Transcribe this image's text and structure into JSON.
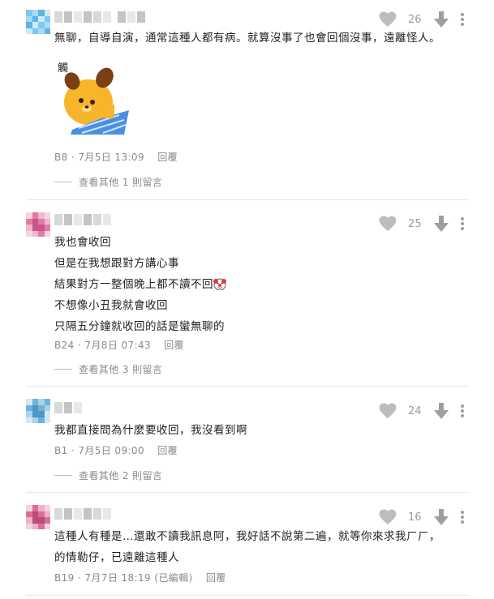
{
  "comments": [
    {
      "text_lines": [
        "無聊，自導自演，通常這種人都有病。就算沒事了也會回個沒事，遠離怪人。"
      ],
      "likes": "26",
      "floor": "B8",
      "date": "7月5日 13:09",
      "reply_label": "回覆",
      "view_more": "查看其他 1 則留言",
      "sticker_text": "觸",
      "avatar_colors": [
        "#7ec8f0",
        "#a9d9f5",
        "#5fb3e6",
        "#cfe9f8"
      ]
    },
    {
      "text_lines": [
        "我也會收回",
        "但是在我想跟對方講心事",
        "結果對方一整個晚上都不讀不回",
        "不想像小丑我就會收回",
        "只隔五分鐘就收回的話是蠻無聊的"
      ],
      "likes": "25",
      "floor": "B24",
      "date": "7月8日 07:43",
      "reply_label": "回覆",
      "view_more": "查看其他 3 則留言",
      "avatar_colors": [
        "#e07aa6",
        "#f2b6cf",
        "#c9558a",
        "#f7d4e3"
      ]
    },
    {
      "text_lines": [
        "我都直接問為什麼要收回，我沒看到啊"
      ],
      "likes": "24",
      "floor": "B1",
      "date": "7月5日 09:00",
      "reply_label": "回覆",
      "view_more": "查看其他 2 則留言",
      "avatar_colors": [
        "#6fb2d8",
        "#a7d3ec",
        "#4e97c4",
        "#d2e9f6"
      ]
    },
    {
      "text_lines": [
        "這種人有種是…還敢不讀我訊息阿，我好話不說第二遍，就等你來求我ㄏㄏ，",
        "的情勒仔，已遠離這種人"
      ],
      "likes": "16",
      "floor": "B19",
      "date": "7月7日 18:19 (已編輯)",
      "reply_label": "回覆",
      "avatar_colors": [
        "#d86f9a",
        "#eeb0c8",
        "#b84c7c",
        "#f5d2e0"
      ]
    }
  ],
  "icons": {
    "like": "heart-icon",
    "dislike": "arrow-down-icon",
    "more": "more-vertical-icon",
    "emoji": "clown-emoji-icon"
  },
  "colors": {
    "icon": "#bdbdbd",
    "muted_text": "#8a8a8a",
    "divider": "#e6e6e6"
  }
}
